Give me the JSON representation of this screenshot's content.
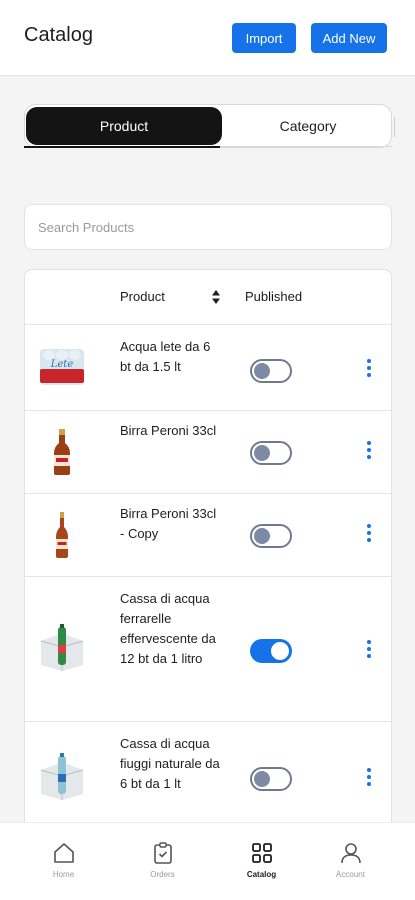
{
  "header": {
    "title": "Catalog",
    "import_label": "Import",
    "add_new_label": "Add New"
  },
  "tabs": {
    "product": "Product",
    "category": "Category"
  },
  "search": {
    "placeholder": "Search Products"
  },
  "table": {
    "col_product": "Product",
    "col_published": "Published",
    "rows": [
      {
        "name": "Acqua lete da 6 bt da 1.5 lt",
        "published": false
      },
      {
        "name": "Birra Peroni 33cl",
        "published": false
      },
      {
        "name": "Birra Peroni 33cl - Copy",
        "published": false
      },
      {
        "name": "Cassa di acqua ferrarelle effervescente da 12 bt da 1 litro",
        "published": true
      },
      {
        "name": "Cassa di acqua fiuggi naturale da 6 bt da 1 lt",
        "published": false
      }
    ]
  },
  "bottom_nav": {
    "home": "Home",
    "orders": "Orders",
    "catalog": "Catalog",
    "account": "Account",
    "active": "catalog"
  },
  "colors": {
    "accent": "#1572e8",
    "tab_active_bg": "#141414",
    "toggle_off_knob": "#7d8aa6"
  }
}
